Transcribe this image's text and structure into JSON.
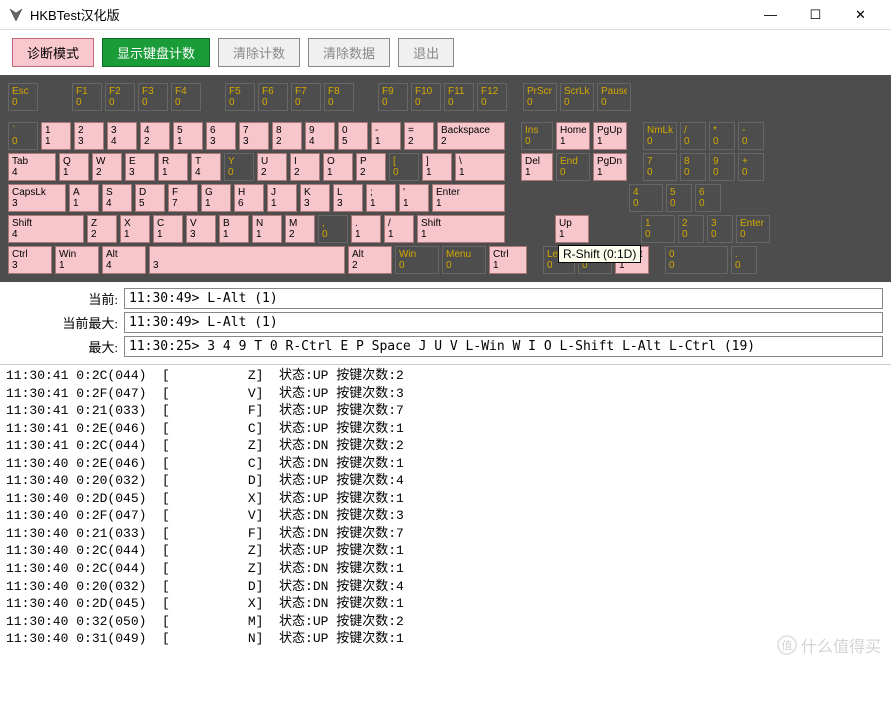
{
  "window": {
    "title": "HKBTest汉化版",
    "minimize": "—",
    "maximize": "☐",
    "close": "✕"
  },
  "toolbar": {
    "diag_mode": "诊断模式",
    "show_count": "显示键盘计数",
    "clear_count": "清除计数",
    "clear_data": "清除数据",
    "exit": "退出"
  },
  "tooltip": "R-Shift (0:1D)",
  "info": {
    "current_lbl": "当前:",
    "current_val": "11:30:49> L-Alt (1)",
    "curmax_lbl": "当前最大:",
    "curmax_val": "11:30:49> L-Alt (1)",
    "max_lbl": "最大:",
    "max_val": "11:30:25> 3 4 9 T 0 R-Ctrl E P Space J U V L-Win W I O L-Shift L-Alt L-Ctrl (19)"
  },
  "watermark": "什么值得买",
  "keys": {
    "r0": [
      {
        "l": "Esc",
        "c": "0",
        "w": 30
      },
      {
        "sp": 28
      },
      {
        "l": "F1",
        "c": "0",
        "w": 30
      },
      {
        "l": "F2",
        "c": "0",
        "w": 30
      },
      {
        "l": "F3",
        "c": "0",
        "w": 30
      },
      {
        "l": "F4",
        "c": "0",
        "w": 30
      },
      {
        "sp": 18
      },
      {
        "l": "F5",
        "c": "0",
        "w": 30
      },
      {
        "l": "F6",
        "c": "0",
        "w": 30
      },
      {
        "l": "F7",
        "c": "0",
        "w": 30
      },
      {
        "l": "F8",
        "c": "0",
        "w": 30
      },
      {
        "sp": 18
      },
      {
        "l": "F9",
        "c": "0",
        "w": 30
      },
      {
        "l": "F10",
        "c": "0",
        "w": 30
      },
      {
        "l": "F11",
        "c": "0",
        "w": 30
      },
      {
        "l": "F12",
        "c": "0",
        "w": 30
      },
      {
        "sp": 10
      },
      {
        "l": "PrScr",
        "c": "0",
        "w": 34
      },
      {
        "l": "ScrLk",
        "c": "0",
        "w": 34
      },
      {
        "l": "Pause",
        "c": "0",
        "w": 34
      }
    ],
    "r1": [
      {
        "l": "`",
        "c": "0",
        "w": 30
      },
      {
        "l": "1",
        "c": "1",
        "w": 30,
        "pk": 1
      },
      {
        "l": "2",
        "c": "3",
        "w": 30,
        "pk": 1
      },
      {
        "l": "3",
        "c": "4",
        "w": 30,
        "pk": 1
      },
      {
        "l": "4",
        "c": "2",
        "w": 30,
        "pk": 1
      },
      {
        "l": "5",
        "c": "1",
        "w": 30,
        "pk": 1
      },
      {
        "l": "6",
        "c": "3",
        "w": 30,
        "pk": 1
      },
      {
        "l": "7",
        "c": "3",
        "w": 30,
        "pk": 1
      },
      {
        "l": "8",
        "c": "2",
        "w": 30,
        "pk": 1
      },
      {
        "l": "9",
        "c": "4",
        "w": 30,
        "pk": 1
      },
      {
        "l": "0",
        "c": "5",
        "w": 30,
        "pk": 1
      },
      {
        "l": "-",
        "c": "1",
        "w": 30,
        "pk": 1
      },
      {
        "l": "=",
        "c": "2",
        "w": 30,
        "pk": 1
      },
      {
        "l": "Backspace",
        "c": "2",
        "w": 68,
        "pk": 1
      },
      {
        "sp": 10
      },
      {
        "l": "Ins",
        "c": "0",
        "w": 32
      },
      {
        "l": "Home",
        "c": "1",
        "w": 34,
        "pk": 1
      },
      {
        "l": "PgUp",
        "c": "1",
        "w": 34,
        "pk": 1
      },
      {
        "sp": 10
      },
      {
        "l": "NmLk",
        "c": "0",
        "w": 34
      },
      {
        "l": "/",
        "c": "0",
        "w": 26
      },
      {
        "l": "*",
        "c": "0",
        "w": 26
      },
      {
        "l": "-",
        "c": "0",
        "w": 26
      }
    ],
    "r2": [
      {
        "l": "Tab",
        "c": "4",
        "w": 48,
        "pk": 1
      },
      {
        "l": "Q",
        "c": "1",
        "w": 30,
        "pk": 1
      },
      {
        "l": "W",
        "c": "2",
        "w": 30,
        "pk": 1
      },
      {
        "l": "E",
        "c": "3",
        "w": 30,
        "pk": 1
      },
      {
        "l": "R",
        "c": "1",
        "w": 30,
        "pk": 1
      },
      {
        "l": "T",
        "c": "4",
        "w": 30,
        "pk": 1
      },
      {
        "l": "Y",
        "c": "0",
        "w": 30
      },
      {
        "l": "U",
        "c": "2",
        "w": 30,
        "pk": 1
      },
      {
        "l": "I",
        "c": "2",
        "w": 30,
        "pk": 1
      },
      {
        "l": "O",
        "c": "1",
        "w": 30,
        "pk": 1
      },
      {
        "l": "P",
        "c": "2",
        "w": 30,
        "pk": 1
      },
      {
        "l": "[",
        "c": "0",
        "w": 30
      },
      {
        "l": "]",
        "c": "1",
        "w": 30,
        "pk": 1
      },
      {
        "l": "\\",
        "c": "1",
        "w": 50,
        "pk": 1
      },
      {
        "sp": 10
      },
      {
        "l": "Del",
        "c": "1",
        "w": 32,
        "pk": 1
      },
      {
        "l": "End",
        "c": "0",
        "w": 34
      },
      {
        "l": "PgDn",
        "c": "1",
        "w": 34,
        "pk": 1
      },
      {
        "sp": 10
      },
      {
        "l": "7",
        "c": "0",
        "w": 34
      },
      {
        "l": "8",
        "c": "0",
        "w": 26
      },
      {
        "l": "9",
        "c": "0",
        "w": 26
      },
      {
        "l": "+",
        "c": "0",
        "w": 26
      }
    ],
    "r3": [
      {
        "l": "CapsLk",
        "c": "3",
        "w": 58,
        "pk": 1
      },
      {
        "l": "A",
        "c": "1",
        "w": 30,
        "pk": 1
      },
      {
        "l": "S",
        "c": "4",
        "w": 30,
        "pk": 1
      },
      {
        "l": "D",
        "c": "5",
        "w": 30,
        "pk": 1
      },
      {
        "l": "F",
        "c": "7",
        "w": 30,
        "pk": 1
      },
      {
        "l": "G",
        "c": "1",
        "w": 30,
        "pk": 1
      },
      {
        "l": "H",
        "c": "6",
        "w": 30,
        "pk": 1
      },
      {
        "l": "J",
        "c": "1",
        "w": 30,
        "pk": 1
      },
      {
        "l": "K",
        "c": "3",
        "w": 30,
        "pk": 1
      },
      {
        "l": "L",
        "c": "3",
        "w": 30,
        "pk": 1
      },
      {
        "l": ";",
        "c": "1",
        "w": 30,
        "pk": 1
      },
      {
        "l": "'",
        "c": "1",
        "w": 30,
        "pk": 1
      },
      {
        "l": "Enter",
        "c": "1",
        "w": 73,
        "pk": 1
      },
      {
        "sp": 118
      },
      {
        "l": "4",
        "c": "0",
        "w": 34
      },
      {
        "l": "5",
        "c": "0",
        "w": 26
      },
      {
        "l": "6",
        "c": "0",
        "w": 26
      }
    ],
    "r4": [
      {
        "l": "Shift",
        "c": "4",
        "w": 76,
        "pk": 1
      },
      {
        "l": "Z",
        "c": "2",
        "w": 30,
        "pk": 1
      },
      {
        "l": "X",
        "c": "1",
        "w": 30,
        "pk": 1
      },
      {
        "l": "C",
        "c": "1",
        "w": 30,
        "pk": 1
      },
      {
        "l": "V",
        "c": "3",
        "w": 30,
        "pk": 1
      },
      {
        "l": "B",
        "c": "1",
        "w": 30,
        "pk": 1
      },
      {
        "l": "N",
        "c": "1",
        "w": 30,
        "pk": 1
      },
      {
        "l": "M",
        "c": "2",
        "w": 30,
        "pk": 1
      },
      {
        "l": ",",
        "c": "0",
        "w": 30
      },
      {
        "l": ".",
        "c": "1",
        "w": 30,
        "pk": 1
      },
      {
        "l": "/",
        "c": "1",
        "w": 30,
        "pk": 1
      },
      {
        "l": "Shift",
        "c": "1",
        "w": 88,
        "pk": 1
      },
      {
        "sp": 44
      },
      {
        "l": "Up",
        "c": "1",
        "w": 34,
        "pk": 1
      },
      {
        "sp": 46
      },
      {
        "l": "1",
        "c": "0",
        "w": 34
      },
      {
        "l": "2",
        "c": "0",
        "w": 26
      },
      {
        "l": "3",
        "c": "0",
        "w": 26
      },
      {
        "l": "Enter",
        "c": "0",
        "w": 34
      }
    ],
    "r5": [
      {
        "l": "Ctrl",
        "c": "3",
        "w": 44,
        "pk": 1
      },
      {
        "l": "Win",
        "c": "1",
        "w": 44,
        "pk": 1
      },
      {
        "l": "Alt",
        "c": "4",
        "w": 44,
        "pk": 1
      },
      {
        "l": "",
        "c": "3",
        "w": 196,
        "pk": 1
      },
      {
        "l": "Alt",
        "c": "2",
        "w": 44,
        "pk": 1
      },
      {
        "l": "Win",
        "c": "0",
        "w": 44
      },
      {
        "l": "Menu",
        "c": "0",
        "w": 44
      },
      {
        "l": "Ctrl",
        "c": "1",
        "w": 38,
        "pk": 1
      },
      {
        "sp": 10
      },
      {
        "l": "Left",
        "c": "0",
        "w": 32
      },
      {
        "l": "Down",
        "c": "0",
        "w": 34
      },
      {
        "l": "Right",
        "c": "1",
        "w": 34,
        "pk": 1
      },
      {
        "sp": 10
      },
      {
        "l": "0",
        "c": "0",
        "w": 63
      },
      {
        "l": ".",
        "c": "0",
        "w": 26
      }
    ]
  },
  "log": [
    "11:30:41 0:2C(044)  [          Z]  状态:UP 按键次数:2",
    "11:30:41 0:2F(047)  [          V]  状态:UP 按键次数:3",
    "11:30:41 0:21(033)  [          F]  状态:UP 按键次数:7",
    "11:30:41 0:2E(046)  [          C]  状态:UP 按键次数:1",
    "11:30:41 0:2C(044)  [          Z]  状态:DN 按键次数:2",
    "11:30:40 0:2E(046)  [          C]  状态:DN 按键次数:1",
    "11:30:40 0:20(032)  [          D]  状态:UP 按键次数:4",
    "11:30:40 0:2D(045)  [          X]  状态:UP 按键次数:1",
    "11:30:40 0:2F(047)  [          V]  状态:DN 按键次数:3",
    "11:30:40 0:21(033)  [          F]  状态:DN 按键次数:7",
    "11:30:40 0:2C(044)  [          Z]  状态:UP 按键次数:1",
    "11:30:40 0:2C(044)  [          Z]  状态:DN 按键次数:1",
    "11:30:40 0:20(032)  [          D]  状态:DN 按键次数:4",
    "11:30:40 0:2D(045)  [          X]  状态:DN 按键次数:1",
    "11:30:40 0:32(050)  [          M]  状态:UP 按键次数:2",
    "11:30:40 0:31(049)  [          N]  状态:UP 按键次数:1"
  ]
}
